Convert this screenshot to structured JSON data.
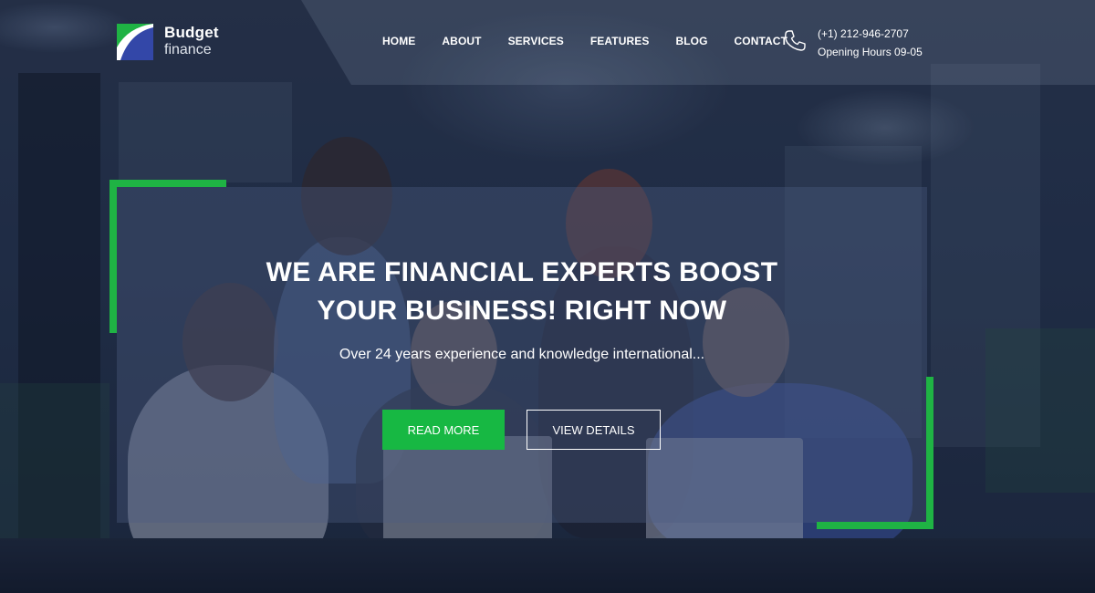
{
  "brand": {
    "name_line1": "Budget",
    "name_line2": "finance",
    "logo_icon": "budget-finance-logo-icon",
    "colors": {
      "green": "#1fb344",
      "blue": "#3347a8"
    }
  },
  "nav": {
    "items": [
      "HOME",
      "ABOUT",
      "SERVICES",
      "FEATURES",
      "BLOG",
      "CONTACT"
    ]
  },
  "contact": {
    "icon": "phone-icon",
    "phone": "(+1) 212-946-2707",
    "hours": "Opening Hours 09-05"
  },
  "hero": {
    "title_line1": "WE ARE FINANCIAL EXPERTS BOOST",
    "title_line2": "YOUR BUSINESS! RIGHT NOW",
    "subtitle": "Over 24 years experience and knowledge international...",
    "primary_button": "READ MORE",
    "secondary_button": "VIEW DETAILS",
    "accent_color": "#17b843"
  }
}
